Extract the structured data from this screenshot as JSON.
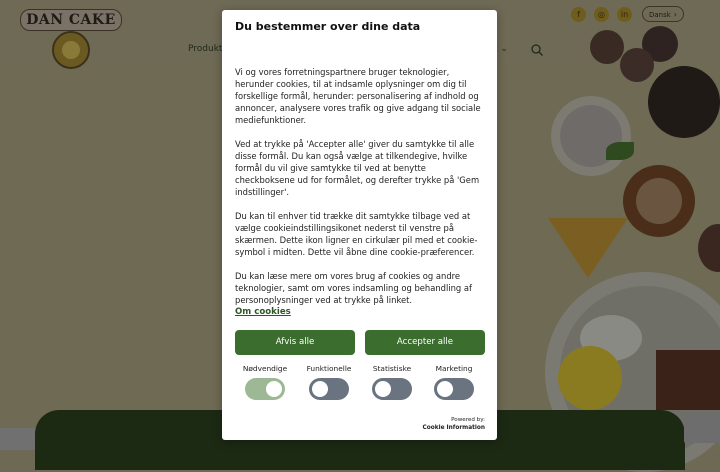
{
  "header": {
    "logo_text": "DAN CAKE",
    "nav": {
      "products": "Produkte",
      "right_item": "t"
    },
    "social": {
      "facebook": "f",
      "instagram": "◎",
      "linkedin": "in"
    },
    "language": "Dansk"
  },
  "modal": {
    "title": "Du bestemmer over dine data",
    "paragraphs": [
      "Vi og vores forretningspartnere bruger teknologier, herunder cookies, til at indsamle oplysninger om dig til forskellige formål, herunder: personalisering af indhold og annoncer, analysere vores trafik og give adgang til sociale mediefunktioner.",
      "Ved at trykke på 'Accepter alle' giver du samtykke til alle disse formål. Du kan også vælge at tilkendegive, hvilke formål du vil give samtykke til ved at benytte checkboksene ud for formålet, og derefter trykke på 'Gem indstillinger'.",
      "Du kan til enhver tid trække dit samtykke tilbage ved at vælge cookieindstillingsikonet nederst til venstre på skærmen. Dette ikon ligner en cirkulær pil med et cookie-symbol i midten. Dette vil åbne dine cookie-præferencer.",
      "Du kan læse mere om vores brug af cookies og andre teknologier, samt om vores indsamling og behandling af personoplysninger ved at trykke på linket."
    ],
    "about_link": "Om cookies",
    "reject_label": "Afvis alle",
    "accept_label": "Accepter alle",
    "toggles": [
      {
        "label": "Nødvendige",
        "on": true
      },
      {
        "label": "Funktionelle",
        "on": false
      },
      {
        "label": "Statistiske",
        "on": false
      },
      {
        "label": "Marketing",
        "on": false
      }
    ],
    "powered_by": "Powered by:",
    "powered_name": "Cookie Information"
  },
  "colors": {
    "primary_button": "#3b6d2f",
    "toggle_on": "#9cb895",
    "toggle_off": "#6a7481"
  }
}
